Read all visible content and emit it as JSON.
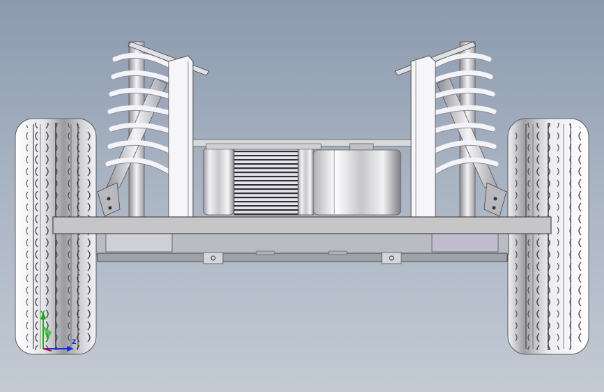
{
  "viewport": {
    "background_top": "#8c9aae",
    "background_bottom": "#c3cad4"
  },
  "colors": {
    "frame": "#c8c8c8",
    "frame_edge": "#4a4a4a",
    "spring": "#f0f0f4",
    "motor_body": "#d9d9de",
    "tire": "#e9e9ec",
    "axis_x": "#e01010",
    "axis_y": "#10b010",
    "axis_z": "#1030e0"
  },
  "triad": {
    "label_y": "Y",
    "label_z": "Z",
    "icon": "coordinate-triad-icon"
  }
}
